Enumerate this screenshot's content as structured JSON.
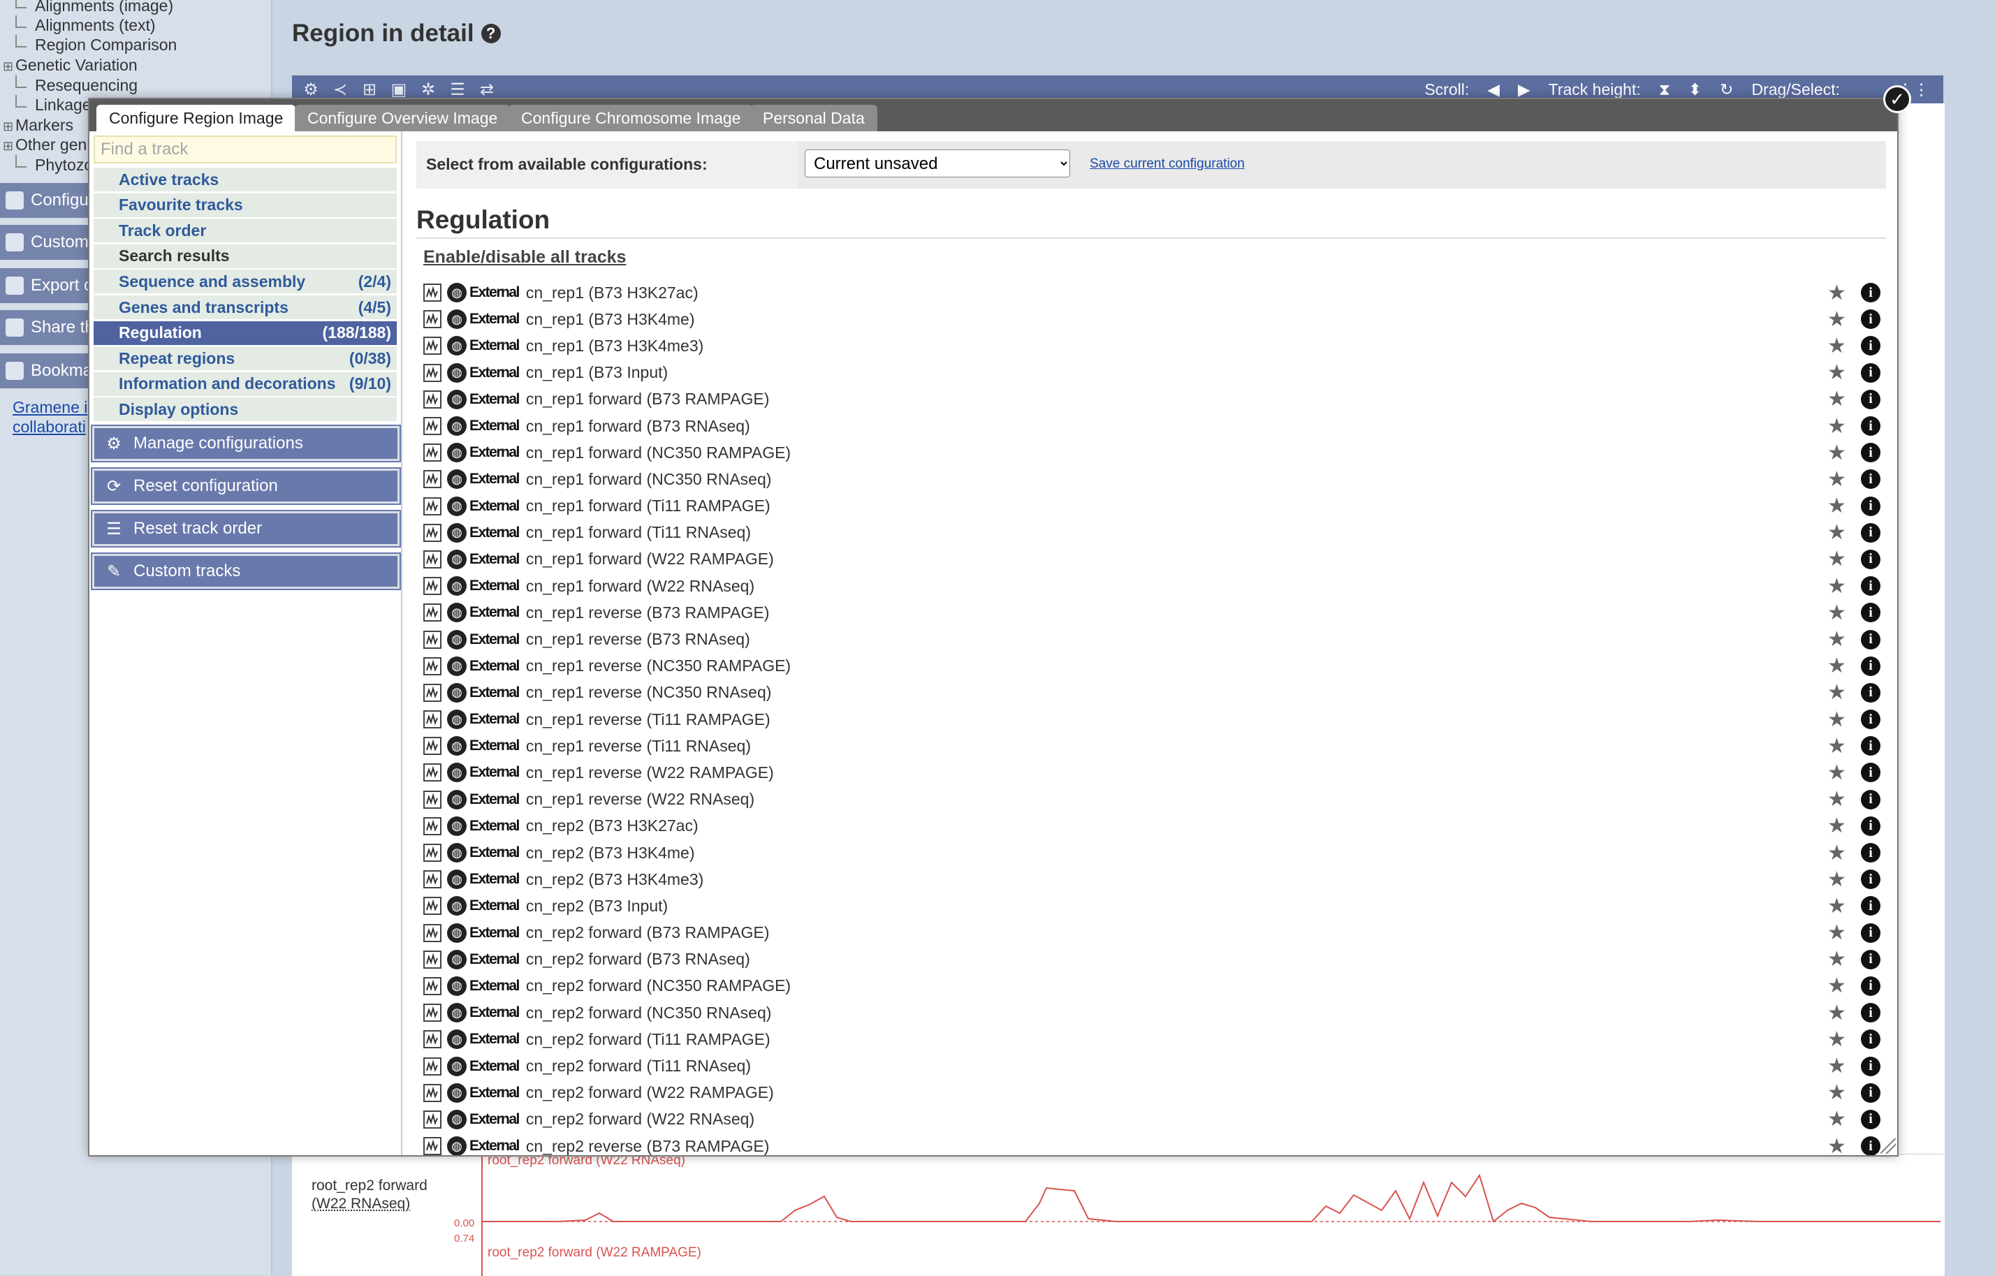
{
  "background": {
    "tree": [
      {
        "label": "Alignments (image)",
        "depth": 1
      },
      {
        "label": "Alignments (text)",
        "depth": 1
      },
      {
        "label": "Region Comparison",
        "depth": 1
      },
      {
        "label": "Genetic Variation",
        "depth": 0
      },
      {
        "label": "Resequencing",
        "depth": 1
      },
      {
        "label": "Linkage",
        "depth": 1
      },
      {
        "label": "Markers",
        "depth": 0
      },
      {
        "label": "Other gen",
        "depth": 0
      },
      {
        "label": "Phytozo",
        "depth": 1
      }
    ],
    "side_buttons": [
      "Configu",
      "Custom",
      "Export c",
      "Share th",
      "Bookma"
    ],
    "side_links": [
      "Gramene i",
      "collaborati"
    ],
    "page_title": "Region in detail",
    "toolbar": {
      "scroll_label": "Scroll:",
      "track_height_label": "Track height:",
      "drag_select_label": "Drag/Select:"
    },
    "tracks": [
      {
        "label_line1": "root_rep2 forward",
        "label_line2": "(W22 RNAseq)",
        "title": "root_rep2 forward (W22 RNAseq)",
        "axis_min": "0.00",
        "axis_max": "0.74"
      },
      {
        "title": "root_rep2 forward (W22 RAMPAGE)"
      }
    ]
  },
  "modal": {
    "tabs": [
      "Configure Region Image",
      "Configure Overview Image",
      "Configure Chromosome Image",
      "Personal Data"
    ],
    "active_tab": 0,
    "find_placeholder": "Find a track",
    "nav": [
      {
        "label": "Active tracks",
        "count": ""
      },
      {
        "label": "Favourite tracks",
        "count": ""
      },
      {
        "label": "Track order",
        "count": ""
      },
      {
        "label": "Search results",
        "count": ""
      },
      {
        "label": "Sequence and assembly",
        "count": "(2/4)"
      },
      {
        "label": "Genes and transcripts",
        "count": "(4/5)"
      },
      {
        "label": "Regulation",
        "count": "(188/188)"
      },
      {
        "label": "Repeat regions",
        "count": "(0/38)"
      },
      {
        "label": "Information and decorations",
        "count": "(9/10)"
      },
      {
        "label": "Display options",
        "count": ""
      }
    ],
    "nav_buttons": [
      "Manage configurations",
      "Reset configuration",
      "Reset track order",
      "Custom tracks"
    ],
    "config_label": "Select from available configurations:",
    "config_value": "Current unsaved",
    "save_config": "Save current configuration",
    "section_title": "Regulation",
    "enable_all": "Enable/disable all tracks",
    "external_label": "External",
    "tracks": [
      "cn_rep1 (B73 H3K27ac)",
      "cn_rep1 (B73 H3K4me)",
      "cn_rep1 (B73 H3K4me3)",
      "cn_rep1 (B73 Input)",
      "cn_rep1 forward (B73 RAMPAGE)",
      "cn_rep1 forward (B73 RNAseq)",
      "cn_rep1 forward (NC350 RAMPAGE)",
      "cn_rep1 forward (NC350 RNAseq)",
      "cn_rep1 forward (Ti11 RAMPAGE)",
      "cn_rep1 forward (Ti11 RNAseq)",
      "cn_rep1 forward (W22 RAMPAGE)",
      "cn_rep1 forward (W22 RNAseq)",
      "cn_rep1 reverse (B73 RAMPAGE)",
      "cn_rep1 reverse (B73 RNAseq)",
      "cn_rep1 reverse (NC350 RAMPAGE)",
      "cn_rep1 reverse (NC350 RNAseq)",
      "cn_rep1 reverse (Ti11 RAMPAGE)",
      "cn_rep1 reverse (Ti11 RNAseq)",
      "cn_rep1 reverse (W22 RAMPAGE)",
      "cn_rep1 reverse (W22 RNAseq)",
      "cn_rep2 (B73 H3K27ac)",
      "cn_rep2 (B73 H3K4me)",
      "cn_rep2 (B73 H3K4me3)",
      "cn_rep2 (B73 Input)",
      "cn_rep2 forward (B73 RAMPAGE)",
      "cn_rep2 forward (B73 RNAseq)",
      "cn_rep2 forward (NC350 RAMPAGE)",
      "cn_rep2 forward (NC350 RNAseq)",
      "cn_rep2 forward (Ti11 RAMPAGE)",
      "cn_rep2 forward (Ti11 RNAseq)",
      "cn_rep2 forward (W22 RAMPAGE)",
      "cn_rep2 forward (W22 RNAseq)",
      "cn_rep2 reverse (B73 RAMPAGE)"
    ]
  },
  "colors": {
    "accent": "#4f63a0",
    "nav_bg": "#e4ebe5",
    "track_line": "#d9534f"
  }
}
